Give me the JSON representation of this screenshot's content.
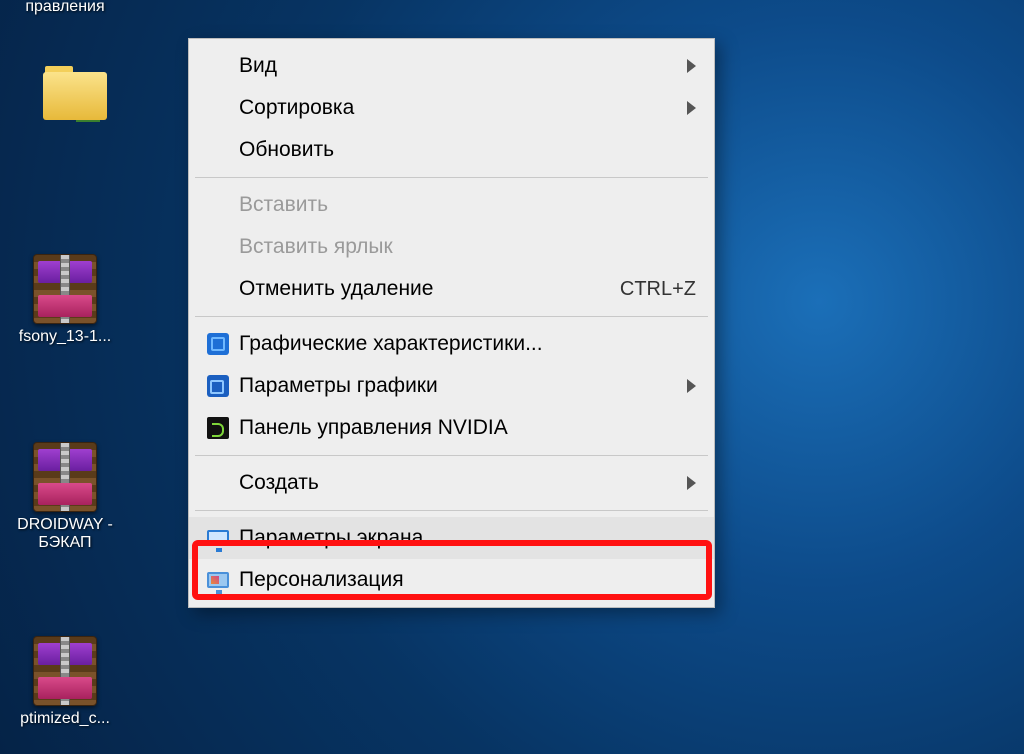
{
  "desktop": {
    "partial_label_top": "правления",
    "icons": [
      {
        "type": "folder-user",
        "label": ""
      },
      {
        "type": "rar",
        "label": "fsony_13-1..."
      },
      {
        "type": "rar",
        "label": "DROIDWAY - БЭКАП"
      },
      {
        "type": "rar",
        "label": "ptimized_c..."
      }
    ]
  },
  "context_menu": {
    "items": [
      {
        "id": "view",
        "label": "Вид",
        "has_submenu": true
      },
      {
        "id": "sort",
        "label": "Сортировка",
        "has_submenu": true
      },
      {
        "id": "refresh",
        "label": "Обновить"
      },
      {
        "sep": true
      },
      {
        "id": "paste",
        "label": "Вставить",
        "disabled": true
      },
      {
        "id": "paste-link",
        "label": "Вставить ярлык",
        "disabled": true
      },
      {
        "id": "undo",
        "label": "Отменить удаление",
        "shortcut": "CTRL+Z"
      },
      {
        "sep": true
      },
      {
        "id": "intel-props",
        "label": "Графические характеристики...",
        "icon": "intel"
      },
      {
        "id": "intel-gfx",
        "label": "Параметры графики",
        "icon": "intel2",
        "has_submenu": true
      },
      {
        "id": "nvidia",
        "label": "Панель управления NVIDIA",
        "icon": "nvidia"
      },
      {
        "sep": true
      },
      {
        "id": "new",
        "label": "Создать",
        "has_submenu": true
      },
      {
        "sep": true
      },
      {
        "id": "display",
        "label": "Параметры экрана",
        "icon": "monitor",
        "highlighted": true
      },
      {
        "id": "personalize",
        "label": "Персонализация",
        "icon": "pers"
      }
    ]
  }
}
